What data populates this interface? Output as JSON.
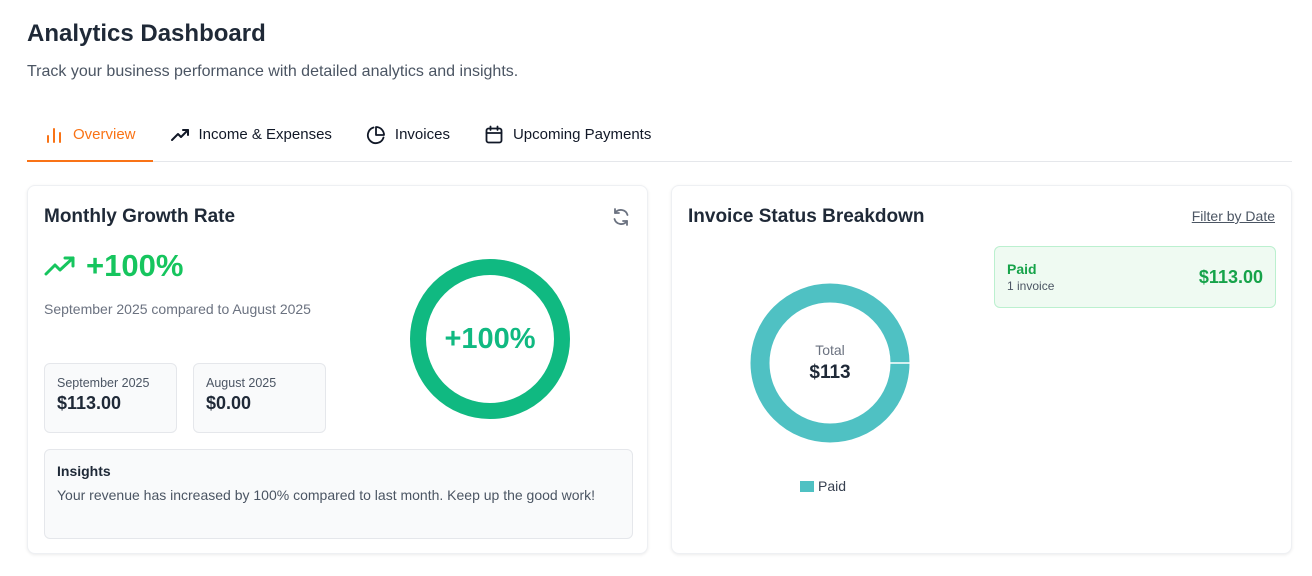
{
  "header": {
    "title": "Analytics Dashboard",
    "subtitle": "Track your business performance with detailed analytics and insights."
  },
  "tabs": [
    {
      "label": "Overview",
      "icon": "bar-chart-icon",
      "active": true
    },
    {
      "label": "Income & Expenses",
      "icon": "trending-up-icon",
      "active": false
    },
    {
      "label": "Invoices",
      "icon": "pie-chart-icon",
      "active": false
    },
    {
      "label": "Upcoming Payments",
      "icon": "calendar-icon",
      "active": false
    }
  ],
  "growth_card": {
    "title": "Monthly Growth Rate",
    "growth_value": "+100%",
    "comparison": "September 2025 compared to August 2025",
    "stats": [
      {
        "label": "September 2025",
        "value": "$113.00"
      },
      {
        "label": "August 2025",
        "value": "$0.00"
      }
    ],
    "ring_label": "+100%",
    "ring_fraction": 1.0,
    "insights_title": "Insights",
    "insights_text": "Your revenue has increased by 100% compared to last month. Keep up the good work!"
  },
  "invoice_card": {
    "title": "Invoice Status Breakdown",
    "filter_label": "Filter by Date",
    "total_label": "Total",
    "total_value": "$113",
    "legend_label": "Paid",
    "status": {
      "name": "Paid",
      "count": "1 invoice",
      "amount": "$113.00"
    }
  },
  "colors": {
    "accent": "#f97316",
    "growth_green": "#10b981",
    "paid_teal": "#4fc1c3",
    "paid_green": "#16a34a"
  },
  "chart_data": {
    "type": "pie",
    "categories": [
      "Paid"
    ],
    "values": [
      113
    ],
    "title": "",
    "legend": "bottom"
  }
}
